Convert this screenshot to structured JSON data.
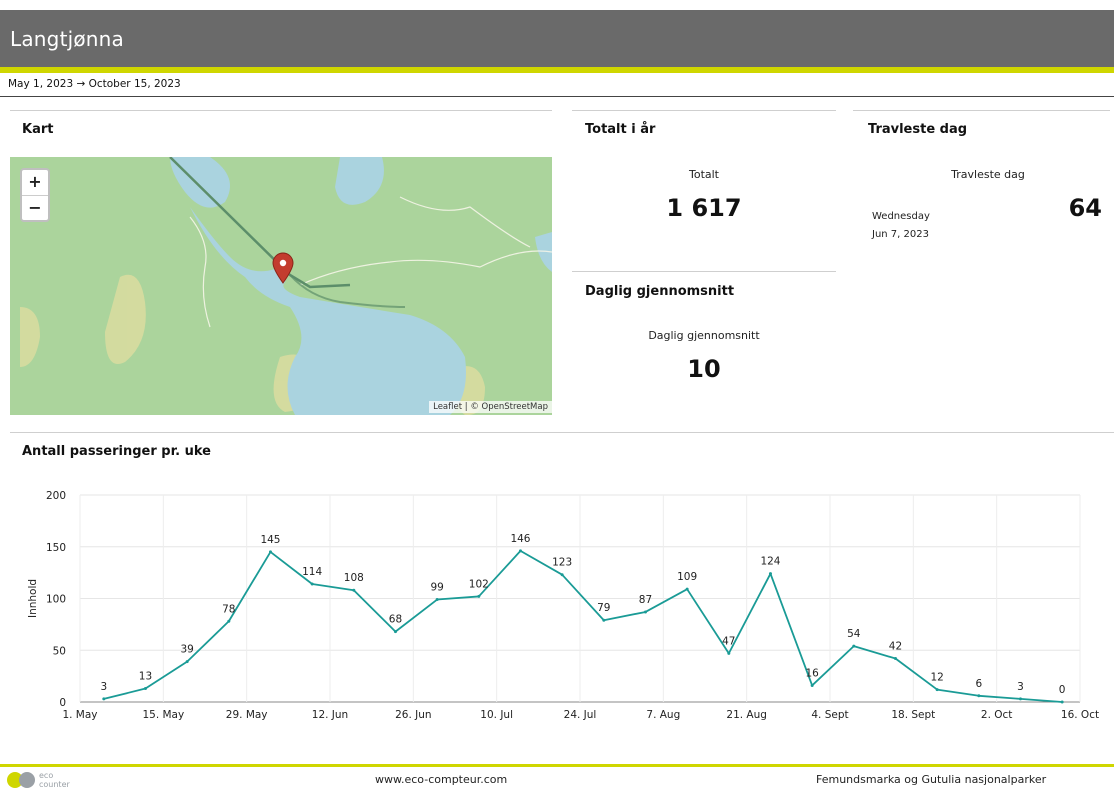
{
  "header": {
    "title": "Langtjønna"
  },
  "date_range": "May 1, 2023 → October 15, 2023",
  "cards": {
    "map": {
      "title": "Kart",
      "zoom_in": "+",
      "zoom_out": "−",
      "attribution": "Leaflet | © OpenStreetMap"
    },
    "total": {
      "title": "Totalt i år",
      "label": "Totalt",
      "value": "1 617"
    },
    "busiest": {
      "title": "Travleste dag",
      "label": "Travleste dag",
      "weekday": "Wednesday",
      "date": "Jun 7, 2023",
      "value": "64"
    },
    "average": {
      "title": "Daglig gjennomsnitt",
      "label": "Daglig gjennomsnitt",
      "value": "10"
    }
  },
  "chart_title": "Antall passeringer pr. uke",
  "chart_data": {
    "type": "line",
    "ylabel": "Innhold",
    "ylim": [
      0,
      200
    ],
    "yticks": [
      0,
      50,
      100,
      150,
      200
    ],
    "xticks": [
      "1. May",
      "15. May",
      "29. May",
      "12. Jun",
      "26. Jun",
      "10. Jul",
      "24. Jul",
      "7. Aug",
      "21. Aug",
      "4. Sept",
      "18. Sept",
      "2. Oct",
      "16. Oct"
    ],
    "x": [
      "2023-05-05",
      "2023-05-12",
      "2023-05-19",
      "2023-05-26",
      "2023-06-02",
      "2023-06-09",
      "2023-06-16",
      "2023-06-23",
      "2023-06-30",
      "2023-07-07",
      "2023-07-14",
      "2023-07-21",
      "2023-07-28",
      "2023-08-04",
      "2023-08-11",
      "2023-08-18",
      "2023-08-25",
      "2023-09-01",
      "2023-09-08",
      "2023-09-15",
      "2023-09-22",
      "2023-09-29",
      "2023-10-06",
      "2023-10-13"
    ],
    "values": [
      3,
      13,
      39,
      78,
      145,
      114,
      108,
      68,
      99,
      102,
      146,
      123,
      79,
      87,
      109,
      47,
      124,
      16,
      54,
      42,
      12,
      6,
      3,
      0
    ],
    "color": "#1a9b96",
    "grid": true
  },
  "footer": {
    "logo_text": "eco counter",
    "website": "www.eco-compteur.com",
    "park": "Femundsmarka og Gutulia nasjonalparker"
  },
  "colors": {
    "header": "#6a6a6a",
    "accent": "#cfd600",
    "line": "#1a9b96"
  }
}
